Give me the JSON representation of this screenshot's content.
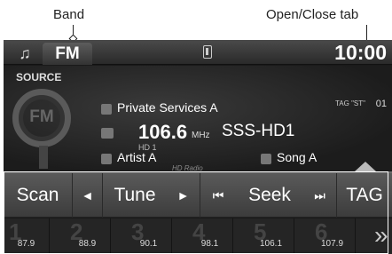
{
  "annotations": {
    "band": "Band",
    "open_close": "Open/Close tab"
  },
  "topbar": {
    "music_icon": "music-note-icon",
    "band": "FM",
    "clock": "10:00"
  },
  "main": {
    "source_label": "SOURCE",
    "logo_text": "FM",
    "service": "Private Services A",
    "frequency": "106.6",
    "unit": "MHz",
    "station": "SSS-HD1",
    "hd_channel": "HD 1",
    "tag_label": "TAG \"ST\"",
    "tag_num": "01",
    "artist": "Artist A",
    "song": "Song A",
    "hd_logo": "HD Radio"
  },
  "controls": {
    "scan": "Scan",
    "tune_down": "◄",
    "tune": "Tune",
    "tune_up": "►",
    "seek_down": "⏮",
    "seek": "Seek",
    "seek_up": "⏭",
    "tag": "TAG"
  },
  "presets": [
    {
      "num": "1",
      "freq": "87.9"
    },
    {
      "num": "2",
      "freq": "88.9"
    },
    {
      "num": "3",
      "freq": "90.1"
    },
    {
      "num": "4",
      "freq": "98.1"
    },
    {
      "num": "5",
      "freq": "106.1"
    },
    {
      "num": "6",
      "freq": "107.9"
    }
  ],
  "presets_next": "»"
}
